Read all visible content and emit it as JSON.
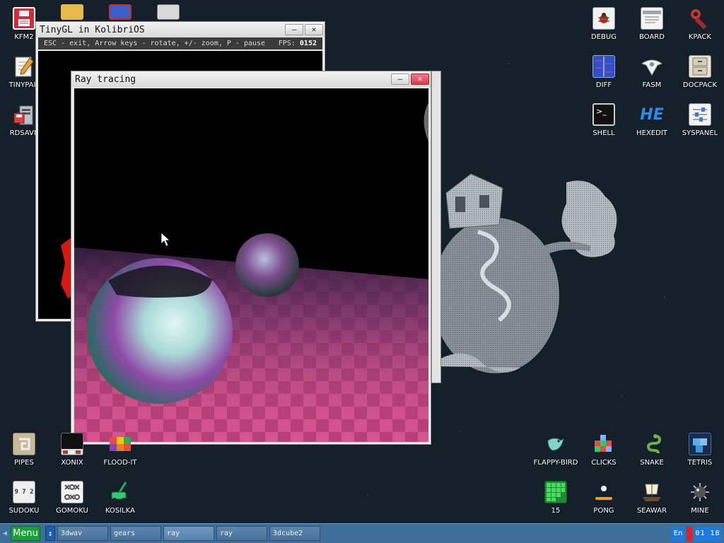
{
  "desktop": {
    "left_icons": [
      {
        "name": "kfm2-icon",
        "label": "KFM2",
        "icon": "floppy-disk-icon"
      },
      {
        "name": "tinypad-icon",
        "label": "TINYPAD",
        "icon": "notepad-icon"
      },
      {
        "name": "rdsave-icon",
        "label": "RDSAVE",
        "icon": "ramdisk-save-icon"
      }
    ],
    "right_icons": [
      {
        "name": "debug-icon",
        "label": "DEBUG"
      },
      {
        "name": "board-icon",
        "label": "BOARD"
      },
      {
        "name": "kpack-icon",
        "label": "KPACK"
      },
      {
        "name": "diff-icon",
        "label": "DIFF"
      },
      {
        "name": "fasm-icon",
        "label": "FASM"
      },
      {
        "name": "docpack-icon",
        "label": "DOCPACK"
      },
      {
        "name": "shell-icon",
        "label": "SHELL",
        "glyph": ">_"
      },
      {
        "name": "hexedit-icon",
        "label": "HEXEDIT",
        "glyph": "HE"
      },
      {
        "name": "syspanel-icon",
        "label": "SYSPANEL"
      }
    ],
    "bottom_left_icons": [
      {
        "name": "pipes-icon",
        "label": "PIPES"
      },
      {
        "name": "xonix-icon",
        "label": "XONIX"
      },
      {
        "name": "flood-it-icon",
        "label": "FLOOD-IT"
      },
      {
        "name": "sudoku-icon",
        "label": "SUDOKU",
        "glyph": "9 7 2"
      },
      {
        "name": "gomoku-icon",
        "label": "GOMOKU"
      },
      {
        "name": "kosilka-icon",
        "label": "KOSILKA"
      }
    ],
    "bottom_right_icons": [
      {
        "name": "flappy-bird-icon",
        "label": "FLAPPY-BIRD"
      },
      {
        "name": "clicks-icon",
        "label": "CLICKS"
      },
      {
        "name": "snake-icon",
        "label": "SNAKE"
      },
      {
        "name": "tetris-icon",
        "label": "TETRIS"
      },
      {
        "name": "fifteen-icon",
        "label": "15"
      },
      {
        "name": "pong-icon",
        "label": "PONG"
      },
      {
        "name": "seawar-icon",
        "label": "SEAWAR"
      },
      {
        "name": "mine-icon",
        "label": "MINE"
      }
    ]
  },
  "windows": {
    "tinygl": {
      "title": "TinyGL in KolibriOS",
      "hint": "ESC - exit, Arrow keys - rotate, +/- zoom, P - pause",
      "fps_label": "FPS:",
      "fps_value": "0152",
      "minimize_glyph": "–",
      "close_glyph": "✕"
    },
    "ray": {
      "title": "Ray tracing",
      "minimize_glyph": "–",
      "close_glyph": "✕"
    }
  },
  "taskbar": {
    "menu_label": "Menu",
    "switch_glyph": "↕",
    "tasks": [
      "3dwav",
      "gears",
      "ray",
      "ray",
      "3dcube2"
    ],
    "active_task_index": 2,
    "language": "En",
    "clock": "01 18"
  },
  "colors": {
    "desktop_bg": "#15202a",
    "taskbar": "#3e6f9b",
    "menu_button": "#1f9d3a",
    "floor_pink": "#c4457c"
  }
}
